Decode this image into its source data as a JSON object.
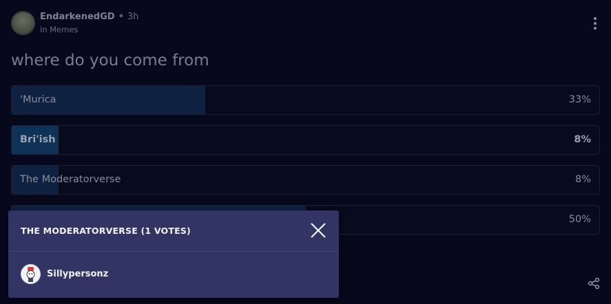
{
  "post": {
    "author": "EndarkenedGD",
    "separator": "•",
    "time": "3h",
    "community": "in Memes",
    "title": "where do you come from"
  },
  "poll": {
    "options": [
      {
        "label": "'Murica",
        "percent_text": "33%",
        "percent": 33
      },
      {
        "label": "Bri'ish",
        "percent_text": "8%",
        "percent": 8
      },
      {
        "label": "The Moderatorverse",
        "percent_text": "8%",
        "percent": 8
      },
      {
        "label": "",
        "percent_text": "50%",
        "percent": 50
      }
    ]
  },
  "modal": {
    "title": "THE MODERATORVERSE (1 VOTES)",
    "voters": [
      {
        "name": "Sillypersonz"
      }
    ]
  },
  "icons": {
    "menu": "kebab-menu-icon",
    "share": "share-icon",
    "close": "close-icon"
  },
  "colors": {
    "background": "#07081b",
    "bar_fill": "#0e2140",
    "bar_fill_highlight": "#0f3356",
    "modal_bg": "#323464"
  }
}
